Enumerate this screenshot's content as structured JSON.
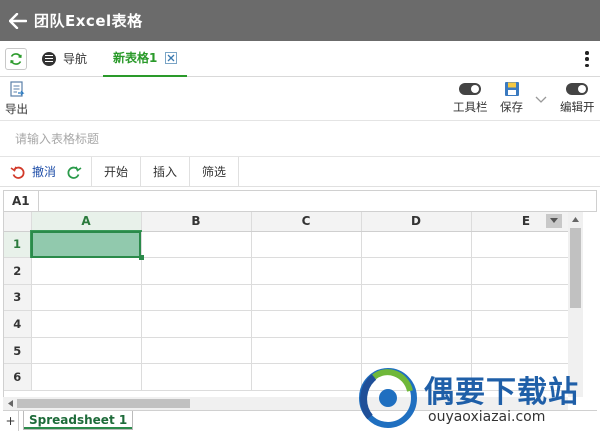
{
  "titlebar": {
    "title": "团队Excel表格"
  },
  "tabs": {
    "nav_label": "导航",
    "active_label": "新表格1"
  },
  "toolbar": {
    "export_label": "导出",
    "toolbar_toggle_label": "工具栏",
    "save_label": "保存",
    "edit_toggle_label": "编辑开"
  },
  "title_input": {
    "placeholder": "请输入表格标题"
  },
  "ribbon": {
    "undo_label": "撤消",
    "tabs": [
      "开始",
      "插入",
      "筛选"
    ]
  },
  "formula_bar": {
    "cell_ref": "A1"
  },
  "grid": {
    "columns": [
      "A",
      "B",
      "C",
      "D",
      "E"
    ],
    "rows": [
      "1",
      "2",
      "3",
      "4",
      "5",
      "6"
    ],
    "active_cell": "A1"
  },
  "sheets": {
    "add_label": "+",
    "tabs": [
      "Spreadsheet 1"
    ]
  },
  "watermark": {
    "brand": "偶要下载站",
    "url": "ouyaoxiazai.com"
  },
  "colors": {
    "accent_green": "#2a9a2a",
    "selection": "#91c9ad",
    "titlebar": "#6b6b6b",
    "undo_blue": "#1f4ea8"
  }
}
